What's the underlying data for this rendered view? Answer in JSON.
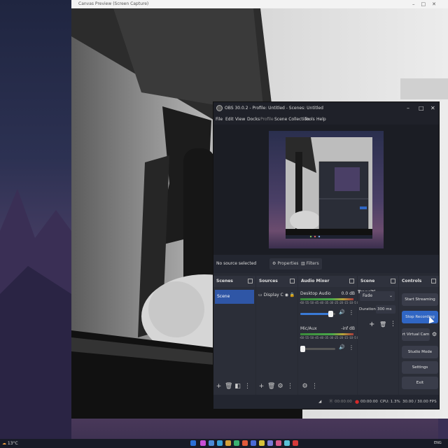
{
  "projector": {
    "title": "Canvas Preview (Screen Capture)",
    "controls": "–□✕"
  },
  "obs": {
    "title": "OBS 30.0.2 - Profile: Untitled - Scenes: Untitled",
    "window_controls": [
      "–",
      "□",
      "✕"
    ],
    "menu": [
      "File",
      "Edit",
      "View",
      "Docks",
      "Profile",
      "Scene Collection",
      "Tools",
      "Help"
    ],
    "source_bar": {
      "status": "No source selected",
      "properties": "Properties",
      "filters": "Filters"
    },
    "docks": {
      "scenes": {
        "title": "Scenes",
        "items": [
          "Scene"
        ]
      },
      "sources": {
        "title": "Sources",
        "items": [
          "Display C"
        ]
      },
      "audio_mixer": {
        "title": "Audio Mixer",
        "ticks": "-60 -55 -50 -45 -40 -35 -30 -25 -20 -15 -10 -5 0",
        "channels": [
          {
            "name": "Desktop Audio",
            "level": "0.0 dB",
            "volume": 0.85
          },
          {
            "name": "Mic/Aux",
            "level": "-inf dB",
            "volume": 0.05
          }
        ]
      },
      "transitions": {
        "title": "Scene Transiti...",
        "type": "Fade",
        "duration_label": "Duration",
        "duration_value": "300 ms"
      },
      "controls": {
        "title": "Controls",
        "buttons": [
          "Start Streaming",
          "Stop Recording",
          "rt Virtual Cam",
          "Studio Mode",
          "Settings",
          "Exit"
        ]
      }
    },
    "status_bar": {
      "stream_time": "00:00:00",
      "record_time": "00:00:00",
      "cpu": "CPU: 1.3%",
      "fps": "30.00 / 30.00 FPS"
    }
  },
  "taskbar": {
    "weather": "13°C",
    "lang": "ENG"
  },
  "colors": {
    "accent": "#3066c4",
    "record": "#d62a2a"
  }
}
